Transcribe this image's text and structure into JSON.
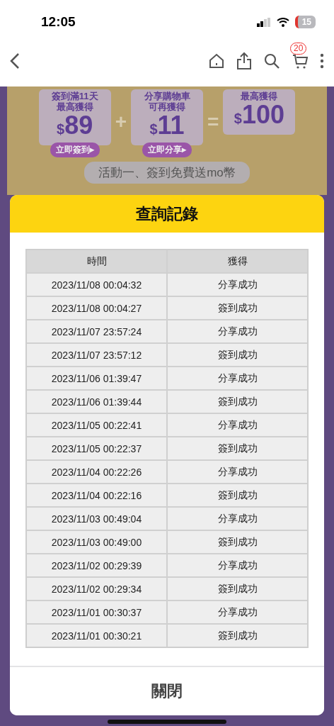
{
  "status_bar": {
    "time": "12:05",
    "battery": "15"
  },
  "nav": {
    "cart_count": "20"
  },
  "banner": {
    "cards": [
      {
        "lines": [
          "簽到滿11天",
          "最高獲得"
        ],
        "currency": "$",
        "amount": "89",
        "button": "立即簽到▸"
      },
      {
        "lines": [
          "分享購物車",
          "可再獲得"
        ],
        "currency": "$",
        "amount": "11",
        "button": "立即分享▸"
      },
      {
        "lines": [
          "最高獲得"
        ],
        "currency": "$",
        "amount": "100"
      }
    ],
    "operators": [
      "+",
      "="
    ],
    "section_title": "活動一、簽到免費送mo幣"
  },
  "dialog": {
    "title": "查詢記錄",
    "table": {
      "columns": [
        "時間",
        "獲得"
      ],
      "rows": [
        [
          "2023/11/08 00:04:32",
          "分享成功"
        ],
        [
          "2023/11/08 00:04:27",
          "簽到成功"
        ],
        [
          "2023/11/07 23:57:24",
          "分享成功"
        ],
        [
          "2023/11/07 23:57:12",
          "簽到成功"
        ],
        [
          "2023/11/06 01:39:47",
          "分享成功"
        ],
        [
          "2023/11/06 01:39:44",
          "簽到成功"
        ],
        [
          "2023/11/05 00:22:41",
          "分享成功"
        ],
        [
          "2023/11/05 00:22:37",
          "簽到成功"
        ],
        [
          "2023/11/04 00:22:26",
          "分享成功"
        ],
        [
          "2023/11/04 00:22:16",
          "簽到成功"
        ],
        [
          "2023/11/03 00:49:04",
          "分享成功"
        ],
        [
          "2023/11/03 00:49:00",
          "簽到成功"
        ],
        [
          "2023/11/02 00:29:39",
          "分享成功"
        ],
        [
          "2023/11/02 00:29:34",
          "簽到成功"
        ],
        [
          "2023/11/01 00:30:37",
          "分享成功"
        ],
        [
          "2023/11/01 00:30:21",
          "簽到成功"
        ]
      ]
    },
    "close_button": "關閉"
  }
}
